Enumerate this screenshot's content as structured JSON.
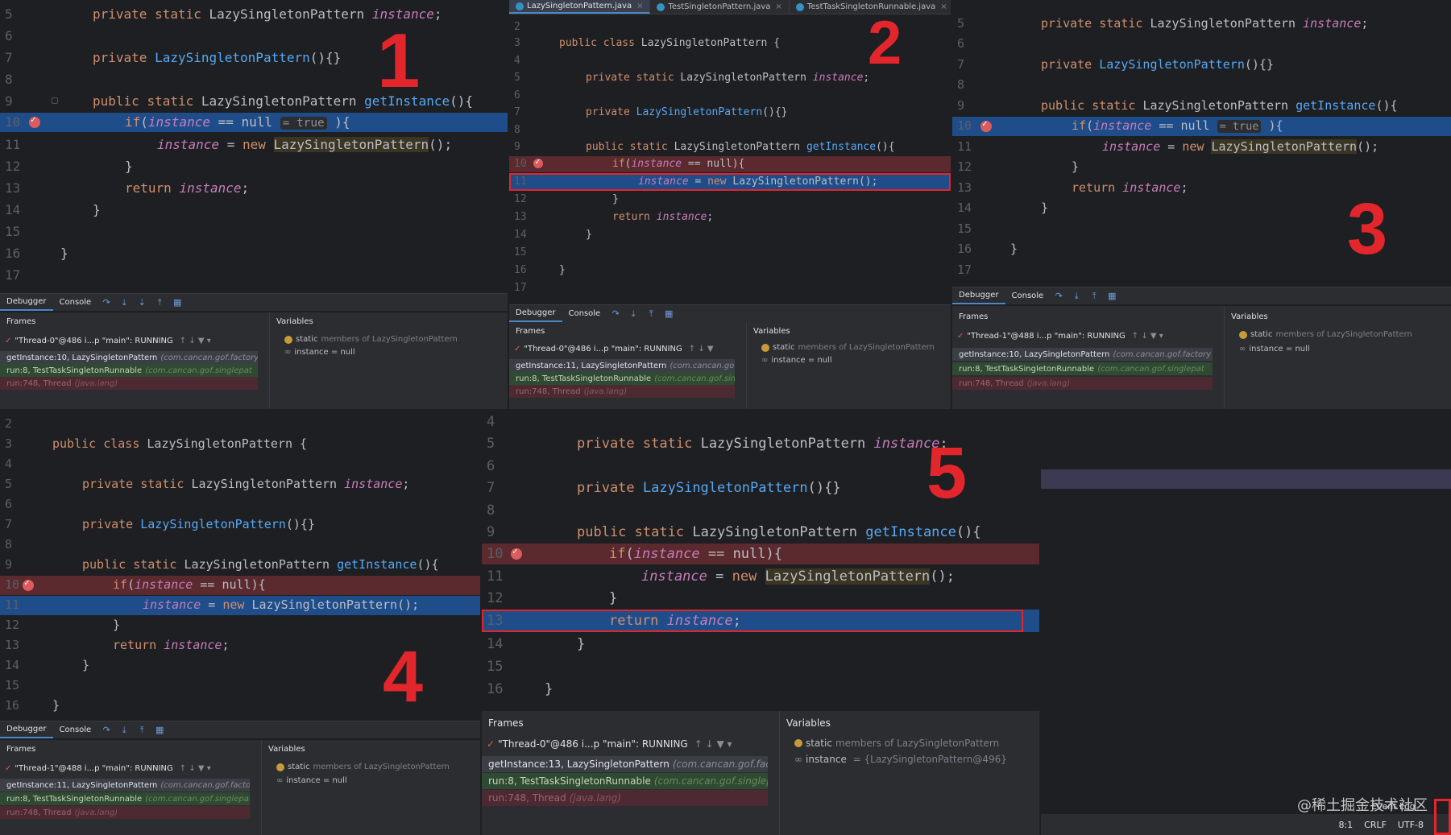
{
  "editor_tabs": [
    {
      "label": "LazySingletonPattern.java",
      "active": true
    },
    {
      "label": "TestSingletonPattern.java",
      "active": false
    },
    {
      "label": "TestTaskSingletonRunnable.java",
      "active": false
    }
  ],
  "tab_close": "×",
  "code": {
    "private": "private",
    "static": "static",
    "public": "public",
    "class": "class",
    "new": "new",
    "return": "return",
    "if": "if",
    "type": "LazySingletonPattern",
    "instance": "instance",
    "semicolon": ";",
    "ctor_tail": "(){}",
    "get_instance": "getInstance",
    "get_tail": "(){",
    "class_open": " {",
    "if_open": "(",
    "if_null": " == null",
    "if_close": "){",
    "inline_hint": "= true",
    "assign": " = ",
    "new_tail": "();",
    "brace_close": "}",
    "class_close": "}"
  },
  "panel_numbers": [
    "1",
    "2",
    "3",
    "4",
    "5"
  ],
  "debugger": {
    "tab_debugger": "Debugger",
    "tab_console": "Console",
    "frames_label": "Frames",
    "variables_label": "Variables",
    "plus": "+",
    "var_static": "static",
    "var_static_desc": "members of LazySingletonPattern",
    "var_instance": "instance",
    "frame_run8": "run:8, TestTaskSingletonRunnable",
    "frame_run8_pkg": "(com.cancan.gof.singlepat",
    "frame_thread": "run:748, Thread",
    "frame_thread_pkg": "(java.lang)",
    "pkg_factory": "(com.cancan.gof.factory"
  },
  "panels": {
    "p1": {
      "thread": "\"Thread-0\"@486 i...p \"main\": RUNNING",
      "frame_top": "getInstance:10, LazySingletonPattern",
      "instance_val": "= null"
    },
    "p2": {
      "thread": "\"Thread-0\"@486 i...p \"main\": RUNNING",
      "frame_top": "getInstance:11, LazySingletonPattern",
      "instance_val": "= null"
    },
    "p3": {
      "thread": "\"Thread-1\"@488 i...p \"main\": RUNNING",
      "frame_top": "getInstance:10, LazySingletonPattern",
      "instance_val": "= null"
    },
    "p4": {
      "thread": "\"Thread-1\"@488 i...p \"main\": RUNNING",
      "frame_top": "getInstance:11, LazySingletonPattern",
      "instance_val": "= null"
    },
    "p5": {
      "thread": "\"Thread-0\"@486 i...p \"main\": RUNNING",
      "frame_top": "getInstance:13, LazySingletonPattern",
      "instance_val": "= {LazySingletonPattern@496}"
    }
  },
  "status": {
    "event_log": "Event Log",
    "pos": "8:1",
    "line_sep": "CRLF",
    "encoding": "UTF-8"
  },
  "watermark": "@稀土掘金技术社区"
}
